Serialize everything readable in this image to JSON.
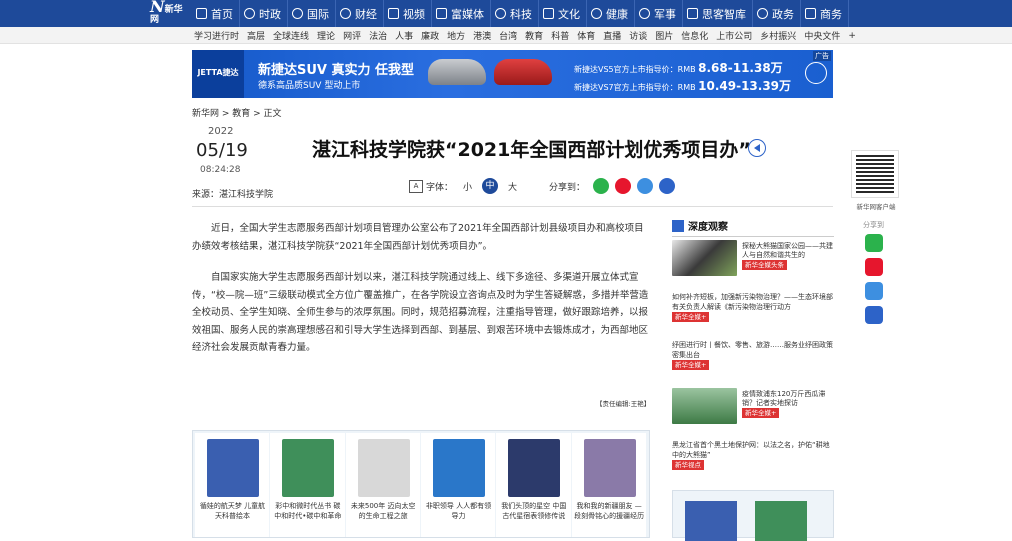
{
  "nav": {
    "logo": "新华网",
    "items": [
      "首页",
      "时政",
      "国际",
      "财经",
      "视频",
      "富媒体",
      "科技",
      "文化",
      "健康",
      "军事",
      "思客智库",
      "政务",
      "商务"
    ]
  },
  "subnav": {
    "items": [
      "学习进行时",
      "高层",
      "全球连线",
      "理论",
      "网评",
      "法治",
      "人事",
      "廉政",
      "地方",
      "港澳",
      "台湾",
      "教育",
      "科普",
      "体育",
      "直播",
      "访谈",
      "图片",
      "信息化",
      "上市公司",
      "乡村振兴",
      "中央文件",
      "+"
    ]
  },
  "ad": {
    "brand": "JETTA捷达",
    "headline": "新捷达SUV 真实力 任我型",
    "sub": "德系高品质SUV 型动上市",
    "price1_label": "新捷达VS5官方上市指导价：RMB",
    "price1": "8.68-11.38万",
    "price2_label": "新捷达VS7官方上市指导价：RMB",
    "price2": "10.49-13.39万",
    "ad_tag": "广告"
  },
  "breadcrumb": "新华网 > 教育 > 正文",
  "date": {
    "year": "2022",
    "monthday": "05/19",
    "time": "08:24:28"
  },
  "source": "来源：湛江科技学院",
  "title": "湛江科技学院获“2021年全国西部计划优秀项目办”",
  "tools": {
    "font_label": "字体：",
    "small": "小",
    "medium": "中",
    "large": "大",
    "share_label": "分享到："
  },
  "article": {
    "p1": "近日，全国大学生志愿服务西部计划项目管理办公室公布了2021年全国西部计划县级项目办和高校项目办绩效考核结果，湛江科技学院获“2021年全国西部计划优秀项目办”。",
    "p2": "自国家实施大学生志愿服务西部计划以来，湛江科技学院通过线上、线下多途径、多渠道开展立体式宣传，“校—院—班”三级联动模式全方位广覆盖推广，在各学院设立咨询点及时为学生答疑解惑，多措并举营造全校动员、全学生知晓、全师生参与的浓厚氛围。同时，规范招募流程，注重指导管理，做好跟踪培养，以报效祖国、服务人民的崇高理想感召和引导大学生选择到西部、到基层、到艰苦环境中去锻炼成才，为西部地区经济社会发展贡献青春力量。",
    "editor": "【责任编辑:王艳】"
  },
  "books": [
    {
      "caption": "循娃的航天梦 儿童航天科普绘本",
      "color": "#3a5fb0"
    },
    {
      "caption": "彩中和微时代丛书 碳中和时代•碳中和革命",
      "color": "#3f8f5a"
    },
    {
      "caption": "未来500年 迈向太空的生命工程之旅",
      "color": "#d8d8d8"
    },
    {
      "caption": "非职领导 人人都有领导力",
      "color": "#2a77c9"
    },
    {
      "caption": "我们头顶的星空 中国古代星宿表领修传说",
      "color": "#2c3a6b"
    },
    {
      "caption": "我和我的新疆朋友 —段刻骨铭心的援疆经历",
      "color": "#8a7aa8"
    }
  ],
  "sidebar": {
    "title": "深度观察",
    "items": [
      {
        "text": "探秘大熊猫国家公园——共建人与自然和谐共生的",
        "badge": "新华全媒头条"
      },
      {
        "text": "如何补齐短板，加强新污染物治理？——生态环境部有关负责人解读《新污染物治理行动方",
        "badge": "新华全媒+"
      },
      {
        "text": "纾困进行时丨餐饮、零售、旅游……服务业纾困政策密集出台",
        "badge": "新华全媒+"
      },
      {
        "text": "疫情致浦东120万斤西瓜滞销？记者实地探访",
        "badge": "新华全媒+"
      },
      {
        "text": "黑龙江省首个黑土地保护网：以法之名，护佑“耕地中的大熊猫”",
        "badge": "新华视点"
      }
    ]
  },
  "float": {
    "qr_caption": "新华网客户端",
    "share": "分享到"
  },
  "colors": {
    "nav": "#1e4a9a",
    "accent": "#2d63c8",
    "badge": "#dd3333"
  }
}
